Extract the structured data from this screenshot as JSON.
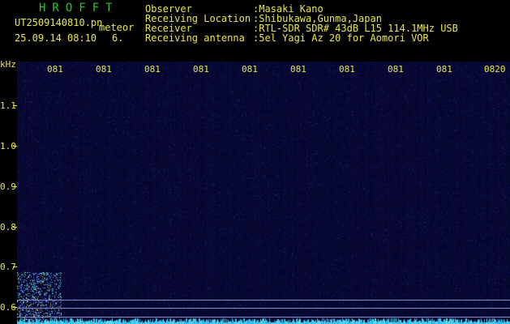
{
  "header": {
    "brand": "HROFFT",
    "filename": "UT2509140810.pn",
    "suffix": "meteor",
    "datetime": "25.09.14 08:10",
    "count": "6.",
    "fields": [
      {
        "label": "Observer",
        "value": ":Masaki Kano"
      },
      {
        "label": "Receiving Location",
        "value": ":Shibukawa,Gunma,Japan"
      },
      {
        "label": "Receiver",
        "value": ":RTL-SDR SDR# 43dB L15 114.1MHz USB"
      },
      {
        "label": "Receiving antenna",
        "value": ":5el Yagi Az 20 for Aomori VOR"
      }
    ]
  },
  "yaxis": {
    "unit": "kHz",
    "ticks": [
      "1.1",
      "1.0",
      "0.9",
      "0.8",
      "0.7",
      "0.6"
    ]
  },
  "xaxis": {
    "ticks": [
      "081",
      "081",
      "081",
      "081",
      "081",
      "081",
      "081",
      "081",
      "081",
      "0820"
    ]
  },
  "colors": {
    "background": "#000000",
    "label": "#e8e84a",
    "brand": "#27c52b",
    "waterfall": "#05062e"
  }
}
